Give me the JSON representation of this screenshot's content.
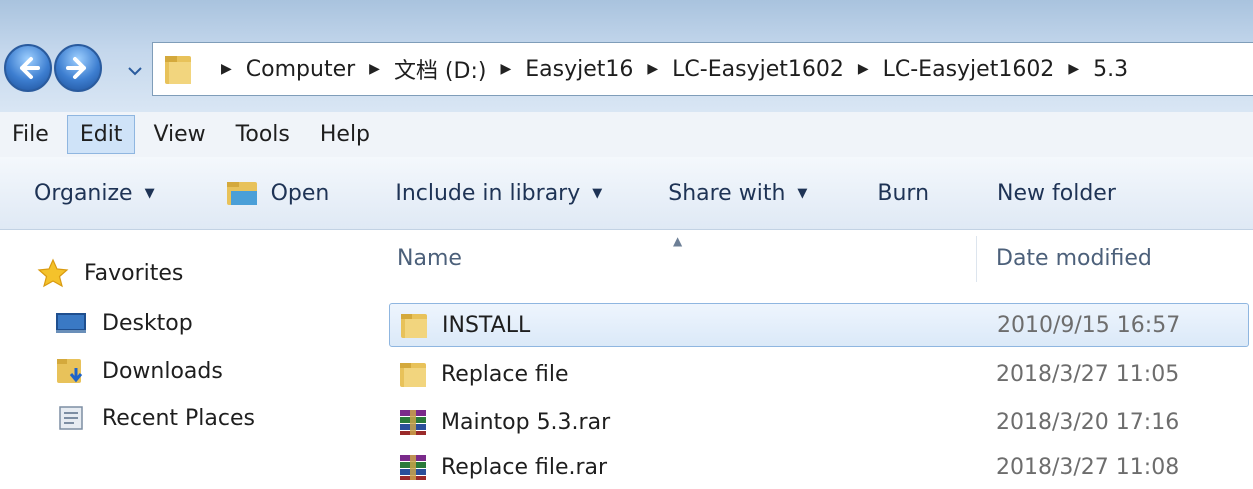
{
  "address_bar": {
    "breadcrumbs": [
      "Computer",
      "文档 (D:)",
      "Easyjet16",
      "LC-Easyjet1602",
      "LC-Easyjet1602",
      "5.3"
    ]
  },
  "menu": {
    "items": [
      "File",
      "Edit",
      "View",
      "Tools",
      "Help"
    ],
    "active": "Edit"
  },
  "toolbar": {
    "organize": "Organize",
    "open": "Open",
    "include_in_library": "Include in library",
    "share_with": "Share with",
    "burn": "Burn",
    "new_folder": "New folder"
  },
  "navigation": {
    "favorites": "Favorites",
    "items": [
      "Desktop",
      "Downloads",
      "Recent Places"
    ]
  },
  "file_list": {
    "columns": {
      "name": "Name",
      "date_modified": "Date modified"
    },
    "rows": [
      {
        "name": "INSTALL",
        "date": "2010/9/15 16:57",
        "icon": "folder-icon",
        "selected": true
      },
      {
        "name": "Replace file",
        "date": "2018/3/27 11:05",
        "icon": "folder-icon",
        "selected": false
      },
      {
        "name": "Maintop 5.3.rar",
        "date": "2018/3/20 17:16",
        "icon": "rar-archive-icon",
        "selected": false
      },
      {
        "name": "Replace file.rar",
        "date": "2018/3/27 11:08",
        "icon": "rar-archive-icon",
        "selected": false
      }
    ]
  },
  "colors": {
    "selection_border": "#8fb6e0",
    "accent_blue": "#3d7ed0",
    "folder_yellow": "#e8c25a"
  }
}
